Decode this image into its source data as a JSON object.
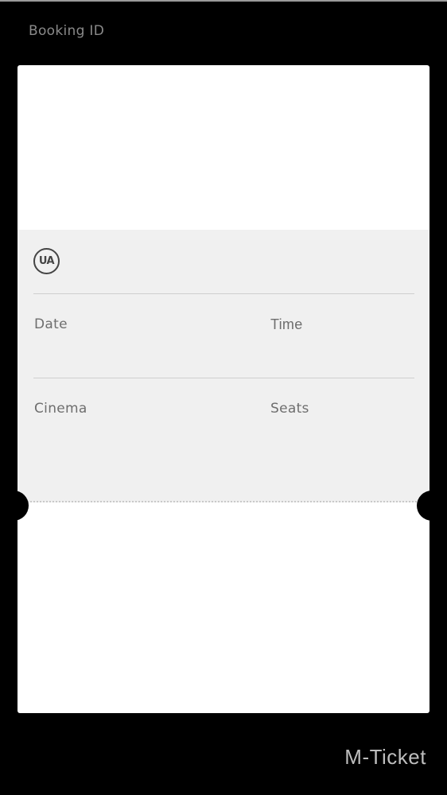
{
  "header": {
    "booking_label": "Booking ID"
  },
  "ticket": {
    "rating_badge": "UA",
    "labels": {
      "date": "Date",
      "time": "Time",
      "cinema": "Cinema",
      "seats": "Seats"
    }
  },
  "footer": {
    "ticket_type": "M-Ticket"
  },
  "colors": {
    "background": "#000000",
    "ticket": "#ffffff",
    "details_panel": "#f0f0f0",
    "label_text": "#6e6e6e"
  }
}
